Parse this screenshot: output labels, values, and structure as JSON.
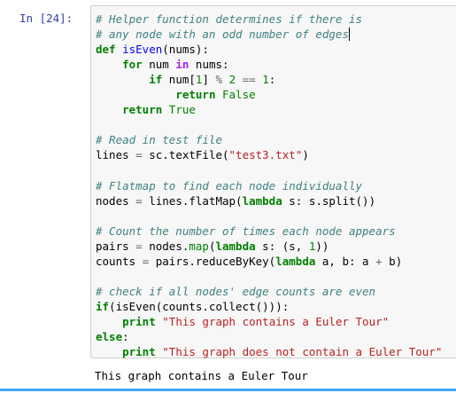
{
  "cell": {
    "prompt": "In [24]:",
    "code_lines": [
      [
        {
          "t": "# Helper function determines if there is",
          "c": "c"
        }
      ],
      [
        {
          "t": "# any node with an odd number of edges",
          "c": "c"
        },
        {
          "t": "",
          "c": "cursor"
        }
      ],
      [
        {
          "t": "def",
          "c": "k"
        },
        {
          "t": " "
        },
        {
          "t": "isEven",
          "c": "f"
        },
        {
          "t": "(nums):"
        }
      ],
      [
        {
          "t": "    "
        },
        {
          "t": "for",
          "c": "k"
        },
        {
          "t": " num "
        },
        {
          "t": "in",
          "c": "ow"
        },
        {
          "t": " nums:"
        }
      ],
      [
        {
          "t": "        "
        },
        {
          "t": "if",
          "c": "k"
        },
        {
          "t": " num["
        },
        {
          "t": "1",
          "c": "n"
        },
        {
          "t": "] "
        },
        {
          "t": "%",
          "c": "o"
        },
        {
          "t": " "
        },
        {
          "t": "2",
          "c": "n"
        },
        {
          "t": " "
        },
        {
          "t": "==",
          "c": "o"
        },
        {
          "t": " "
        },
        {
          "t": "1",
          "c": "n"
        },
        {
          "t": ":"
        }
      ],
      [
        {
          "t": "            "
        },
        {
          "t": "return",
          "c": "k"
        },
        {
          "t": " "
        },
        {
          "t": "False",
          "c": "n"
        }
      ],
      [
        {
          "t": "    "
        },
        {
          "t": "return",
          "c": "k"
        },
        {
          "t": " "
        },
        {
          "t": "True",
          "c": "n"
        }
      ],
      [
        {
          "t": ""
        }
      ],
      [
        {
          "t": "# Read in test file",
          "c": "c"
        }
      ],
      [
        {
          "t": "lines "
        },
        {
          "t": "=",
          "c": "o"
        },
        {
          "t": " sc.textFile("
        },
        {
          "t": "\"test3.txt\"",
          "c": "s"
        },
        {
          "t": ")"
        }
      ],
      [
        {
          "t": ""
        }
      ],
      [
        {
          "t": "# Flatmap to find each node individually",
          "c": "c"
        }
      ],
      [
        {
          "t": "nodes "
        },
        {
          "t": "=",
          "c": "o"
        },
        {
          "t": " lines.flatMap("
        },
        {
          "t": "lambda",
          "c": "k"
        },
        {
          "t": " s: s.split())"
        }
      ],
      [
        {
          "t": ""
        }
      ],
      [
        {
          "t": "# Count the number of times each node appears",
          "c": "c"
        }
      ],
      [
        {
          "t": "pairs "
        },
        {
          "t": "=",
          "c": "o"
        },
        {
          "t": " nodes."
        },
        {
          "t": "map",
          "c": "n"
        },
        {
          "t": "("
        },
        {
          "t": "lambda",
          "c": "k"
        },
        {
          "t": " s: (s, "
        },
        {
          "t": "1",
          "c": "n"
        },
        {
          "t": "))"
        }
      ],
      [
        {
          "t": "counts "
        },
        {
          "t": "=",
          "c": "o"
        },
        {
          "t": " pairs.reduceByKey("
        },
        {
          "t": "lambda",
          "c": "k"
        },
        {
          "t": " a, b: a "
        },
        {
          "t": "+",
          "c": "o"
        },
        {
          "t": " b)"
        }
      ],
      [
        {
          "t": ""
        }
      ],
      [
        {
          "t": "# check if all nodes' edge counts are even",
          "c": "c"
        }
      ],
      [
        {
          "t": "if",
          "c": "k"
        },
        {
          "t": "(isEven(counts.collect())):"
        }
      ],
      [
        {
          "t": "    "
        },
        {
          "t": "print",
          "c": "k"
        },
        {
          "t": " "
        },
        {
          "t": "\"This graph contains a Euler Tour\"",
          "c": "s"
        }
      ],
      [
        {
          "t": "else",
          "c": "k"
        },
        {
          "t": ":"
        }
      ],
      [
        {
          "t": "    "
        },
        {
          "t": "print",
          "c": "k"
        },
        {
          "t": " "
        },
        {
          "t": "\"This graph does not contain a Euler Tour\"",
          "c": "s"
        }
      ]
    ],
    "output": "This graph contains a Euler Tour"
  }
}
